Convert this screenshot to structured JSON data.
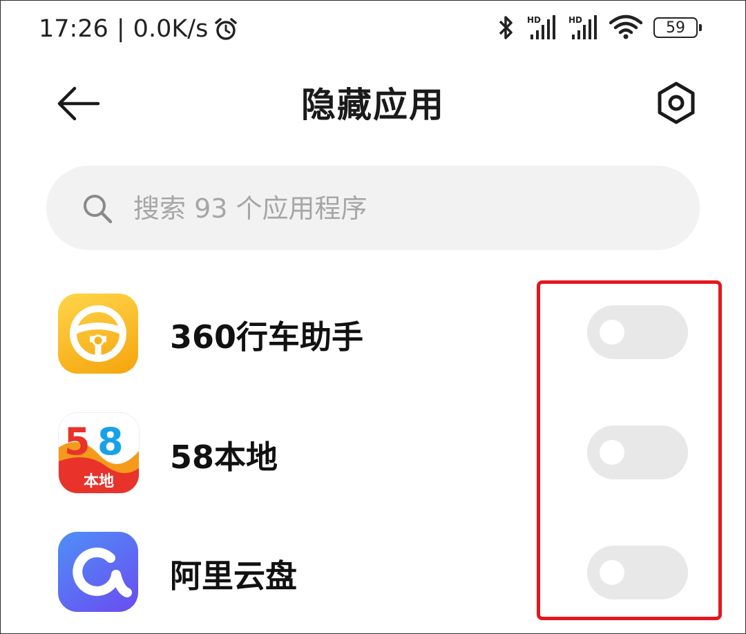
{
  "status_bar": {
    "time": "17:26",
    "separator": "|",
    "speed": "0.0K/s",
    "icons": [
      "alarm-icon",
      "bluetooth-icon",
      "signal-hd-icon",
      "signal-hd-icon",
      "wifi-icon",
      "battery-icon"
    ],
    "signal_label": "HD",
    "battery": "59"
  },
  "header": {
    "title": "隐藏应用",
    "back_icon": "arrow-left-icon",
    "settings_icon": "hexagon-gear-icon"
  },
  "search": {
    "placeholder": "搜索 93 个应用程序",
    "icon": "search-icon"
  },
  "apps": [
    {
      "name": "360行车助手",
      "hidden": false,
      "icon": "steering-wheel-icon",
      "color": "#fbbf20"
    },
    {
      "name": "58本地",
      "hidden": false,
      "icon": "58-logo-icon",
      "badge": "本地",
      "color": "#e8322a"
    },
    {
      "name": "阿里云盘",
      "hidden": false,
      "icon": "cloud-drive-icon",
      "color": "#5b63f2"
    }
  ],
  "colors": {
    "highlight": "#e5161e",
    "toggle_off": "#e8e8e8",
    "search_bg": "#f2f2f2"
  }
}
